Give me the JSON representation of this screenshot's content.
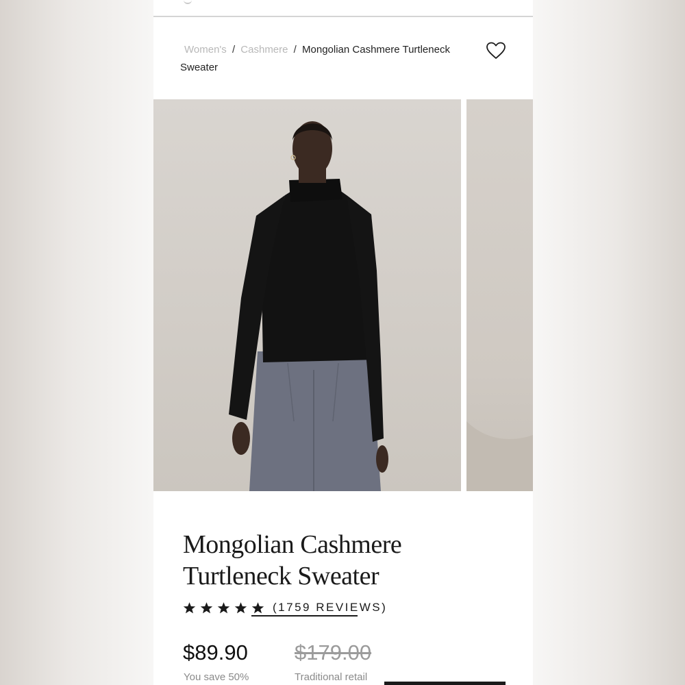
{
  "breadcrumb": {
    "items": [
      "Women's",
      "Cashmere"
    ],
    "separator": "/",
    "current": "Mongolian Cashmere Turtleneck Sweater"
  },
  "wishlist": {
    "icon": "heart-outline-icon"
  },
  "gallery": {
    "images": [
      {
        "subject": "model in black turtleneck sweater and grey trousers"
      },
      {
        "subject": "partial view of next product photo"
      }
    ]
  },
  "product": {
    "title": "Mongolian Cashmere Turtleneck Sweater",
    "rating": 5,
    "reviews_label": "(1759 REVIEWS)",
    "price": "$89.90",
    "savings": "You save 50%",
    "traditional_price": "$179.00",
    "traditional_label": "Traditional retail"
  },
  "colors": {
    "text": "#1a1a1a",
    "muted": "#8a8a8a",
    "link_muted": "#b8b8b8",
    "sweater": "#111111",
    "trousers": "#6d7180",
    "backdrop": "#d5d0ca"
  }
}
